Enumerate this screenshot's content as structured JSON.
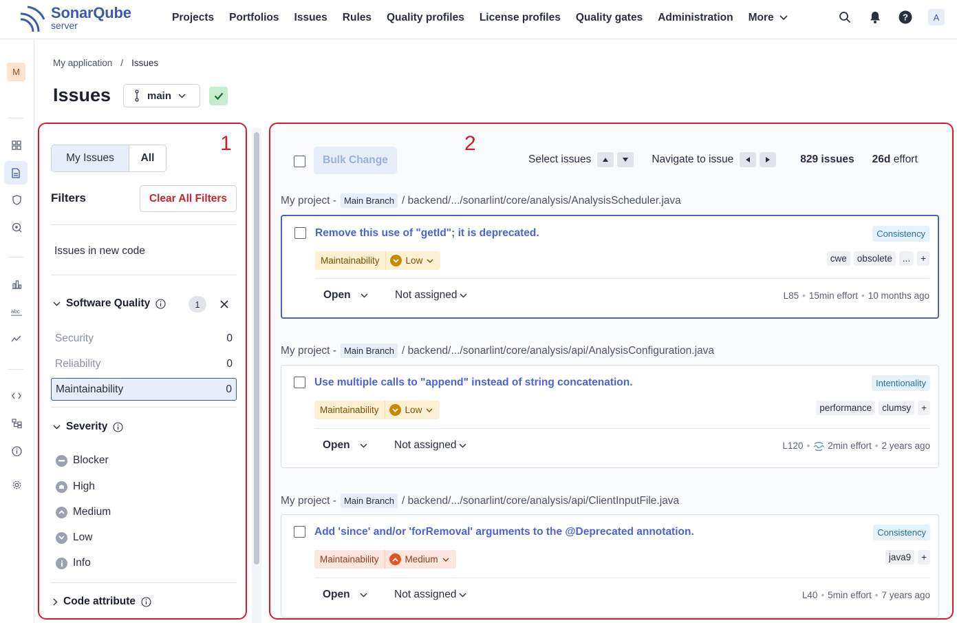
{
  "app": {
    "logo_name": "SonarQube",
    "logo_sub": "server"
  },
  "nav": {
    "items": [
      "Projects",
      "Portfolios",
      "Issues",
      "Rules",
      "Quality profiles",
      "License profiles",
      "Quality gates",
      "Administration"
    ],
    "more": "More",
    "user_initial": "A"
  },
  "rail": {
    "project_initial": "M"
  },
  "breadcrumb": {
    "parent": "My application",
    "sep": "/",
    "current": "Issues"
  },
  "header": {
    "title": "Issues",
    "branch": "main"
  },
  "filters": {
    "region_label": "1",
    "my_issues": "My Issues",
    "all": "All",
    "title": "Filters",
    "clear_all": "Clear All Filters",
    "new_code": "Issues in new code",
    "software_quality": {
      "label": "Software Quality",
      "count": "1",
      "items": [
        {
          "label": "Security",
          "count": "0"
        },
        {
          "label": "Reliability",
          "count": "0"
        },
        {
          "label": "Maintainability",
          "count": "0"
        }
      ]
    },
    "severity": {
      "label": "Severity",
      "items": [
        "Blocker",
        "High",
        "Medium",
        "Low",
        "Info"
      ]
    },
    "code_attribute": "Code attribute"
  },
  "issues_panel": {
    "region_label": "2",
    "bulk_change": "Bulk Change",
    "select_issues": "Select issues",
    "navigate": "Navigate to issue",
    "count": "829 issues",
    "effort_value": "26d",
    "effort_label": "effort"
  },
  "issues": [
    {
      "project": "My project -",
      "branch": "Main Branch",
      "path": "/ backend/.../sonarlint/core/analysis/AnalysisScheduler.java",
      "title": "Remove this use of \"getId\"; it is deprecated.",
      "attribute": "Consistency",
      "quality": "Maintainability",
      "severity": "Low",
      "tags": [
        "cwe",
        "obsolete",
        "...",
        "+"
      ],
      "status": "Open",
      "assignee": "Not assigned",
      "line": "L85",
      "effort": "15min effort",
      "age": "10 months ago"
    },
    {
      "project": "My project -",
      "branch": "Main Branch",
      "path": "/ backend/.../sonarlint/core/analysis/api/AnalysisConfiguration.java",
      "title": "Use multiple calls to \"append\" instead of string concatenation.",
      "attribute": "Intentionality",
      "quality": "Maintainability",
      "severity": "Low",
      "tags": [
        "performance",
        "clumsy",
        "+"
      ],
      "status": "Open",
      "assignee": "Not assigned",
      "line": "L120",
      "effort": "2min effort",
      "age": "2 years ago"
    },
    {
      "project": "My project -",
      "branch": "Main Branch",
      "path": "/ backend/.../sonarlint/core/analysis/api/ClientInputFile.java",
      "title": "Add 'since' and/or 'forRemoval' arguments to the @Deprecated annotation.",
      "attribute": "Consistency",
      "quality": "Maintainability",
      "severity": "Medium",
      "tags": [
        "java9",
        "+"
      ],
      "status": "Open",
      "assignee": "Not assigned",
      "line": "L40",
      "effort": "5min effort",
      "age": "7 years ago"
    }
  ],
  "colors": {
    "accent": "#4b63d6",
    "annotation": "#d11f2a",
    "low": "#c48a00",
    "medium": "#e2551f"
  }
}
